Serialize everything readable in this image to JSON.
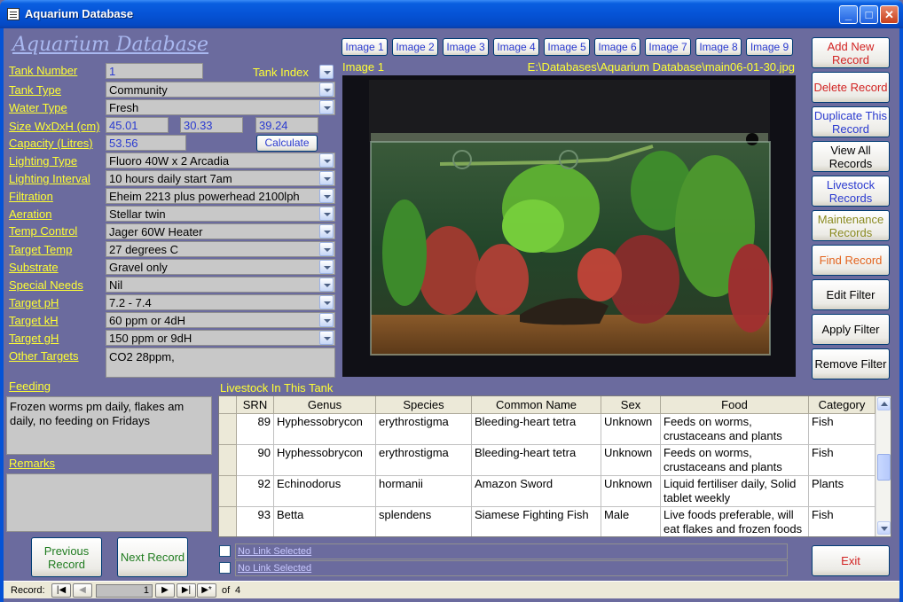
{
  "window": {
    "title": "Aquarium Database"
  },
  "heading": "Aquarium Database",
  "fields": {
    "tank_number": {
      "label": "Tank Number",
      "value": "1"
    },
    "tank_index": {
      "label": "Tank Index"
    },
    "tank_type": {
      "label": "Tank Type",
      "value": "Community"
    },
    "water_type": {
      "label": "Water Type",
      "value": "Fresh"
    },
    "size": {
      "label": "Size WxDxH (cm)",
      "w": "45.01",
      "d": "30.33",
      "h": "39.24"
    },
    "capacity": {
      "label": "Capacity (Litres)",
      "value": "53.56",
      "button": "Calculate"
    },
    "lighting_type": {
      "label": "Lighting Type",
      "value": "Fluoro 40W x 2 Arcadia"
    },
    "lighting_interval": {
      "label": "Lighting Interval",
      "value": "10 hours daily start 7am"
    },
    "filtration": {
      "label": "Filtration",
      "value": "Eheim 2213 plus powerhead 2100lph"
    },
    "aeration": {
      "label": "Aeration",
      "value": "Stellar twin"
    },
    "temp_control": {
      "label": "Temp Control",
      "value": "Jager 60W Heater"
    },
    "target_temp": {
      "label": "Target Temp",
      "value": "27 degrees C"
    },
    "substrate": {
      "label": "Substrate",
      "value": "Gravel only"
    },
    "special_needs": {
      "label": "Special Needs",
      "value": "Nil"
    },
    "target_ph": {
      "label": "Target pH",
      "value": "7.2 - 7.4"
    },
    "target_kh": {
      "label": "Target kH",
      "value": "60 ppm or 4dH"
    },
    "target_gh": {
      "label": "Target gH",
      "value": "150 ppm or 9dH"
    },
    "other_targets": {
      "label": "Other Targets",
      "value": "CO2 28ppm,"
    },
    "feeding": {
      "label": "Feeding",
      "value": "Frozen worms pm daily, flakes am daily, no feeding on Fridays"
    },
    "remarks": {
      "label": "Remarks",
      "value": ""
    }
  },
  "image_tabs": [
    "Image 1",
    "Image 2",
    "Image 3",
    "Image 4",
    "Image 5",
    "Image 6",
    "Image 7",
    "Image 8",
    "Image 9"
  ],
  "image_caption": "Image 1",
  "image_path": "E:\\Databases\\Aquarium Database\\main06-01-30.jpg",
  "side_buttons": {
    "add": "Add New Record",
    "delete": "Delete Record",
    "duplicate": "Duplicate This Record",
    "view_all": "View All Records",
    "livestock": "Livestock Records",
    "maintenance": "Maintenance Records",
    "find": "Find Record",
    "edit_filter": "Edit Filter",
    "apply_filter": "Apply Filter",
    "remove_filter": "Remove Filter",
    "exit": "Exit"
  },
  "nav_buttons": {
    "previous": "Previous Record",
    "next": "Next Record"
  },
  "livestock": {
    "title": "Livestock In This Tank",
    "columns": [
      "SRN",
      "Genus",
      "Species",
      "Common Name",
      "Sex",
      "Food",
      "Category"
    ],
    "rows": [
      [
        "89",
        "Hyphessobrycon",
        "erythrostigma",
        "Bleeding-heart tetra",
        "Unknown",
        "Feeds on worms, crustaceans and plants",
        "Fish"
      ],
      [
        "90",
        "Hyphessobrycon",
        "erythrostigma",
        "Bleeding-heart tetra",
        "Unknown",
        "Feeds on worms, crustaceans and plants",
        "Fish"
      ],
      [
        "92",
        "Echinodorus",
        "hormanii",
        "Amazon Sword",
        "Unknown",
        "Liquid fertiliser daily, Solid tablet weekly",
        "Plants"
      ],
      [
        "93",
        "Betta",
        "splendens",
        "Siamese Fighting Fish",
        "Male",
        "Live foods preferable, will eat flakes and frozen foods",
        "Fish"
      ]
    ]
  },
  "links": [
    "No Link Selected",
    "No Link Selected"
  ],
  "statusbar": {
    "record_label": "Record:",
    "current": "1",
    "of_label": "of",
    "total": "4"
  }
}
